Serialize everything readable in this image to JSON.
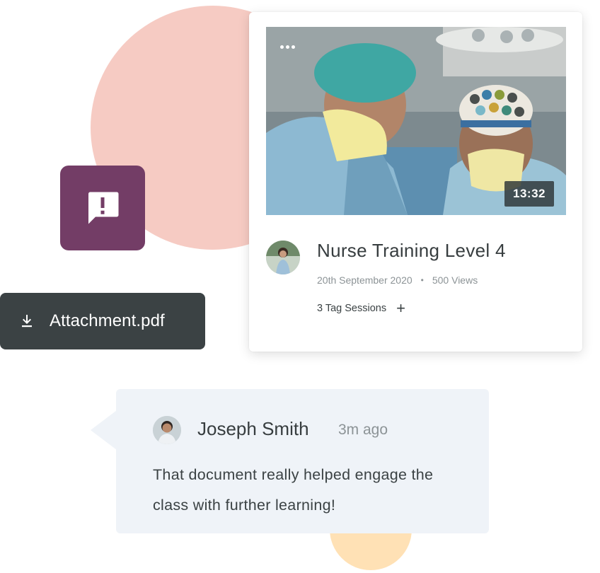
{
  "attachment": {
    "file_name": "Attachment.pdf",
    "icon": "download-icon"
  },
  "alert_tile": {
    "icon": "alert-message-icon",
    "color": "#733d66"
  },
  "video_card": {
    "duration": "13:32",
    "menu_icon": "more-horizontal-icon",
    "title": "Nurse Training Level 4",
    "date": "20th September 2020",
    "separator": "•",
    "views": "500 Views",
    "tag_sessions": "3 Tag Sessions",
    "add_tag_symbol": "+"
  },
  "comment": {
    "author": "Joseph Smith",
    "time": "3m ago",
    "text": "That document really helped engage the class with further learning!"
  },
  "colors": {
    "pink_circle": "#f6cbc3",
    "peach_circle": "#ffe1b5",
    "dark_button": "#3b4244",
    "comment_bg": "#eff3f8"
  }
}
